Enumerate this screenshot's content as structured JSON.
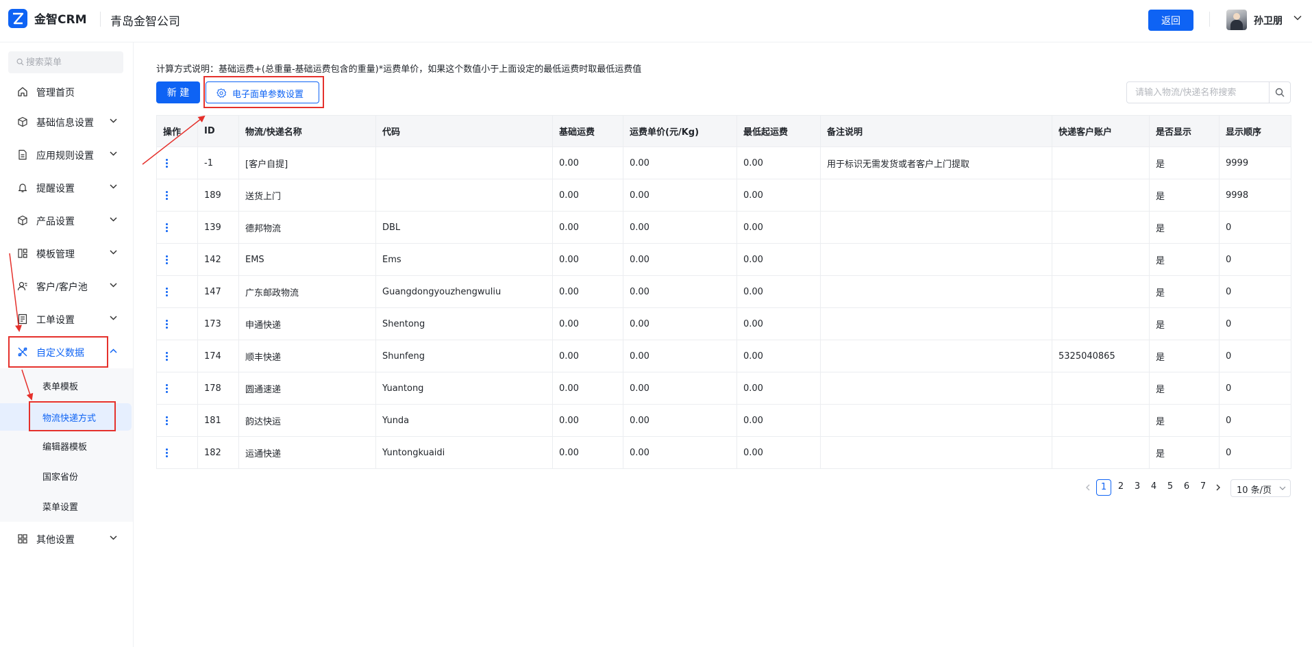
{
  "header": {
    "app_name": "金智CRM",
    "company": "青岛金智公司",
    "back_label": "返回",
    "user_name": "孙卫朋"
  },
  "sidebar": {
    "search_placeholder": "搜索菜单",
    "items": [
      {
        "label": "管理首页",
        "icon": "home-icon"
      },
      {
        "label": "基础信息设置",
        "icon": "cube-icon"
      },
      {
        "label": "应用规则设置",
        "icon": "document-icon"
      },
      {
        "label": "提醒设置",
        "icon": "bell-icon"
      },
      {
        "label": "产品设置",
        "icon": "box-icon"
      },
      {
        "label": "模板管理",
        "icon": "template-icon"
      },
      {
        "label": "客户/客户池",
        "icon": "user-card-icon"
      },
      {
        "label": "工单设置",
        "icon": "ticket-icon"
      },
      {
        "label": "自定义数据",
        "icon": "custom-data-icon"
      },
      {
        "label": "其他设置",
        "icon": "grid-icon"
      }
    ],
    "sub_items": [
      "表单模板",
      "物流快递方式",
      "编辑器模板",
      "国家省份",
      "菜单设置"
    ],
    "selected_sub": "物流快递方式"
  },
  "main": {
    "formula_text": "计算方式说明：基础运费+(总重量-基础运费包含的重量)*运费单价，如果这个数值小于上面设定的最低运费时取最低运费值",
    "new_label": "新 建",
    "param_label": "电子面单参数设置",
    "search_placeholder": "请输入物流/快递名称搜索"
  },
  "table": {
    "columns": [
      "操作",
      "ID",
      "物流/快递名称",
      "代码",
      "基础运费",
      "运费单价(元/Kg)",
      "最低起运费",
      "备注说明",
      "快递客户账户",
      "是否显示",
      "显示顺序"
    ],
    "rows": [
      [
        "-1",
        "[客户自提]",
        "",
        "0.00",
        "0.00",
        "0.00",
        "用于标识无需发货或者客户上门提取",
        "",
        "是",
        "9999"
      ],
      [
        "189",
        "送货上门",
        "",
        "0.00",
        "0.00",
        "0.00",
        "",
        "",
        "是",
        "9998"
      ],
      [
        "139",
        "德邦物流",
        "DBL",
        "0.00",
        "0.00",
        "0.00",
        "",
        "",
        "是",
        "0"
      ],
      [
        "142",
        "EMS",
        "Ems",
        "0.00",
        "0.00",
        "0.00",
        "",
        "",
        "是",
        "0"
      ],
      [
        "147",
        "广东邮政物流",
        "Guangdongyouzhengwuliu",
        "0.00",
        "0.00",
        "0.00",
        "",
        "",
        "是",
        "0"
      ],
      [
        "173",
        "申通快递",
        "Shentong",
        "0.00",
        "0.00",
        "0.00",
        "",
        "",
        "是",
        "0"
      ],
      [
        "174",
        "顺丰快递",
        "Shunfeng",
        "0.00",
        "0.00",
        "0.00",
        "",
        "5325040865",
        "是",
        "0"
      ],
      [
        "178",
        "圆通速递",
        "Yuantong",
        "0.00",
        "0.00",
        "0.00",
        "",
        "",
        "是",
        "0"
      ],
      [
        "181",
        "韵达快运",
        "Yunda",
        "0.00",
        "0.00",
        "0.00",
        "",
        "",
        "是",
        "0"
      ],
      [
        "182",
        "运通快递",
        "Yuntongkuaidi",
        "0.00",
        "0.00",
        "0.00",
        "",
        "",
        "是",
        "0"
      ]
    ]
  },
  "pagination": {
    "pages": [
      "1",
      "2",
      "3",
      "4",
      "5",
      "6",
      "7"
    ],
    "current": "1",
    "page_size": "10 条/页"
  },
  "colors": {
    "accent": "#0e63f4",
    "annotation": "#e5302b"
  }
}
